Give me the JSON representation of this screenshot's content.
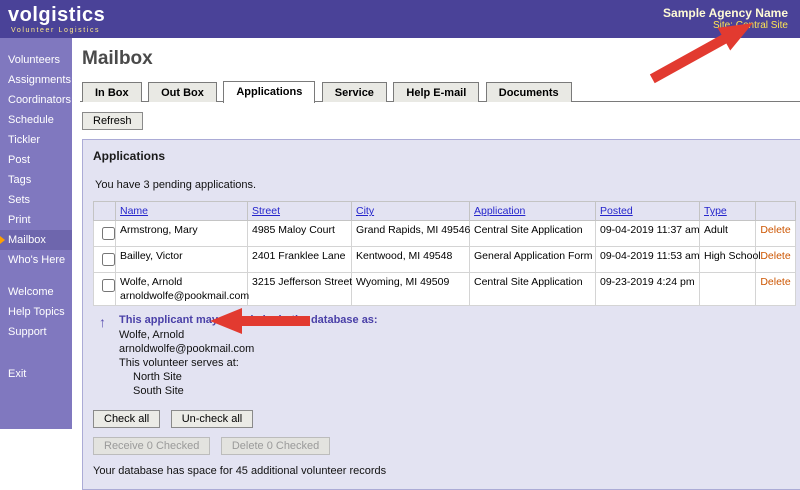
{
  "header": {
    "logo": "volgistics",
    "tagline": "Volunteer Logistics",
    "agency_name": "Sample Agency Name",
    "site": "Site: Central Site"
  },
  "sidebar": {
    "items": [
      "Volunteers",
      "Assignments",
      "Coordinators",
      "Schedule",
      "Tickler",
      "Post",
      "Tags",
      "Sets",
      "Print",
      "Mailbox",
      "Who's Here",
      "Welcome",
      "Help Topics",
      "Support",
      "Exit"
    ],
    "active_item": "Mailbox"
  },
  "page": {
    "title": "Mailbox",
    "tabs": [
      "In Box",
      "Out Box",
      "Applications",
      "Service",
      "Help E-mail",
      "Documents"
    ],
    "active_tab": "Applications",
    "refresh_label": "Refresh"
  },
  "panel": {
    "title": "Applications",
    "pending_text": "You have 3 pending applications.",
    "table": {
      "columns": [
        "Name",
        "Street",
        "City",
        "Application",
        "Posted",
        "Type"
      ],
      "delete_label": "Delete",
      "rows": [
        {
          "name": "Armstrong, Mary",
          "street": "4985 Maloy Court",
          "city": "Grand Rapids, MI 49546",
          "application": "Central Site Application",
          "posted": "09-04-2019 11:37 am",
          "type": "Adult"
        },
        {
          "name": "Bailley, Victor",
          "street": "2401 Franklee Lane",
          "city": "Kentwood, MI 49548",
          "application": "General Application Form",
          "posted": "09-04-2019 11:53 am",
          "type": "High School"
        },
        {
          "name": "Wolfe, Arnold",
          "email": "arnoldwolfe@pookmail.com",
          "street": "3215 Jefferson Street",
          "city": "Wyoming, MI 49509",
          "application": "Central Site Application",
          "posted": "09-23-2019 4:24 pm",
          "type": ""
        }
      ]
    },
    "notice": {
      "arrow_glyph": "↑",
      "heading": "This applicant may already be in the database as:",
      "name": "Wolfe, Arnold",
      "email": "arnoldwolfe@pookmail.com",
      "serves_label": "This volunteer serves at:",
      "sites": [
        "North Site",
        "South Site"
      ]
    },
    "buttons": {
      "check_all": "Check all",
      "uncheck_all": "Un-check all",
      "receive": "Receive 0 Checked",
      "delete": "Delete 0 Checked"
    },
    "footer_text": "Your database has space for 45 additional volunteer records"
  },
  "colors": {
    "header_purple": "#4a4298",
    "sidebar_purple": "#8078bf",
    "active_item_marker": "#ffa000",
    "panel_lavender": "#e3e3f2",
    "link_blue": "#2525cc",
    "delete_orange": "#cc5500",
    "notice_purple": "#4a40a8",
    "annotation_red": "#e23a30",
    "agency_yellow": "#ffe552"
  }
}
